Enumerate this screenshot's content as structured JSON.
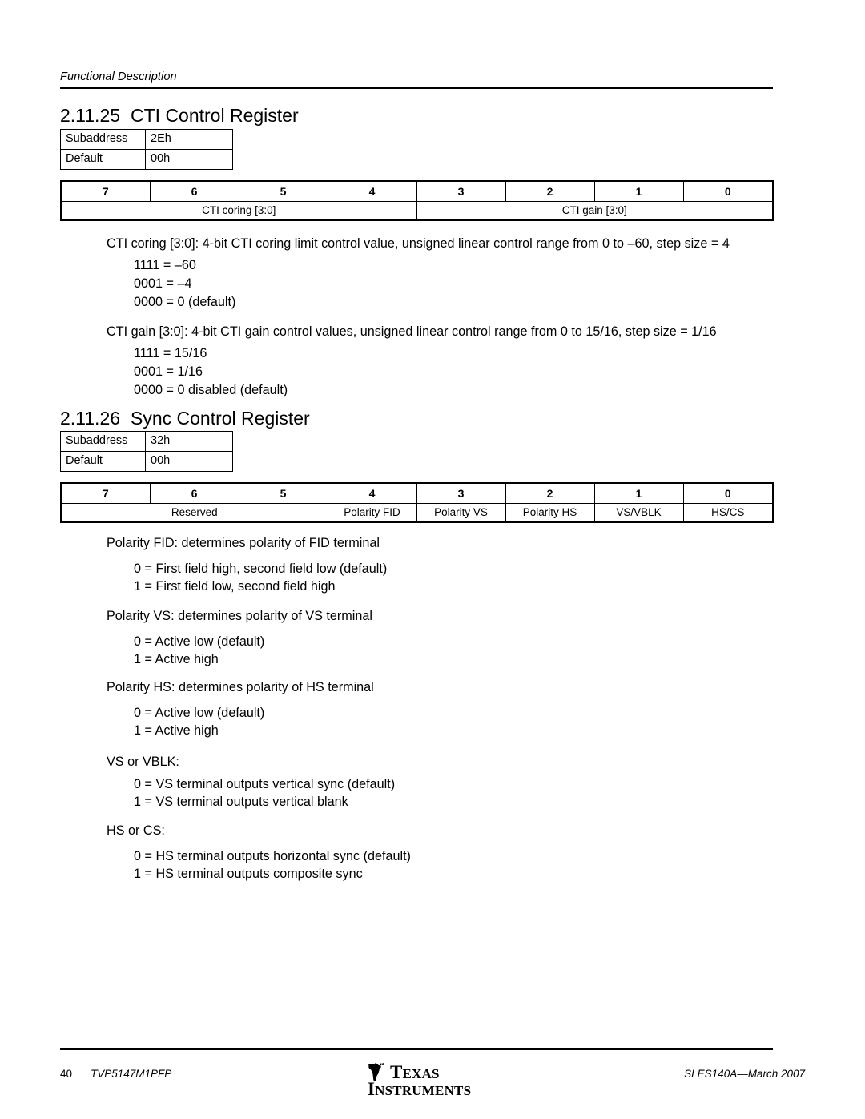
{
  "header": {
    "running_title": "Functional Description"
  },
  "sections": [
    {
      "number": "2.11.25",
      "title": "CTI Control Register",
      "info_table": {
        "rows": [
          {
            "label": "Subaddress",
            "value": "2Eh"
          },
          {
            "label": "Default",
            "value": "00h"
          }
        ]
      },
      "bit_table": {
        "bit_numbers": [
          "7",
          "6",
          "5",
          "4",
          "3",
          "2",
          "1",
          "0"
        ],
        "fields": [
          {
            "name": "CTI coring [3:0]",
            "span": 4
          },
          {
            "name": "CTI gain [3:0]",
            "span": 4
          }
        ]
      },
      "descriptions": [
        {
          "lead": "CTI coring [3:0]: 4-bit CTI coring limit control value, unsigned linear control range from 0 to –60, step size = 4",
          "items": [
            "1111 = –60",
            "0001 = –4",
            "0000 = 0 (default)"
          ]
        },
        {
          "lead": "CTI gain [3:0]: 4-bit CTI gain control values, unsigned linear control range from 0 to 15/16, step size = 1/16",
          "items": [
            "1111 = 15/16",
            "0001 = 1/16",
            "0000 = 0 disabled (default)"
          ]
        }
      ]
    },
    {
      "number": "2.11.26",
      "title": "Sync Control Register",
      "info_table": {
        "rows": [
          {
            "label": "Subaddress",
            "value": "32h"
          },
          {
            "label": "Default",
            "value": "00h"
          }
        ]
      },
      "bit_table": {
        "bit_numbers": [
          "7",
          "6",
          "5",
          "4",
          "3",
          "2",
          "1",
          "0"
        ],
        "fields": [
          {
            "name": "Reserved",
            "span": 3
          },
          {
            "name": "Polarity FID",
            "span": 1
          },
          {
            "name": "Polarity VS",
            "span": 1
          },
          {
            "name": "Polarity HS",
            "span": 1
          },
          {
            "name": "VS/VBLK",
            "span": 1
          },
          {
            "name": "HS/CS",
            "span": 1
          }
        ]
      },
      "descriptions": [
        {
          "lead": "Polarity FID: determines polarity of FID terminal",
          "items": [
            "0 = First field high, second field low (default)",
            "1 = First field low, second field high"
          ]
        },
        {
          "lead": "Polarity VS: determines polarity of VS terminal",
          "items": [
            "0 = Active low (default)",
            "1 = Active high"
          ]
        },
        {
          "lead": "Polarity HS: determines polarity of HS terminal",
          "items": [
            "0 = Active low (default)",
            "1 = Active high"
          ]
        },
        {
          "lead": "VS or VBLK:",
          "items": [
            "0 = VS terminal outputs vertical sync (default)",
            "1 = VS terminal outputs vertical blank"
          ]
        },
        {
          "lead": "HS or CS:",
          "items": [
            "0 = HS terminal outputs horizontal sync (default)",
            "1 = HS terminal outputs composite sync"
          ]
        }
      ]
    }
  ],
  "footer": {
    "page_number": "40",
    "part_number": "TVP5147M1PFP",
    "document_id": "SLES140A—March 2007",
    "logo": {
      "line1": "TEXAS",
      "line2": "INSTRUMENTS"
    }
  }
}
